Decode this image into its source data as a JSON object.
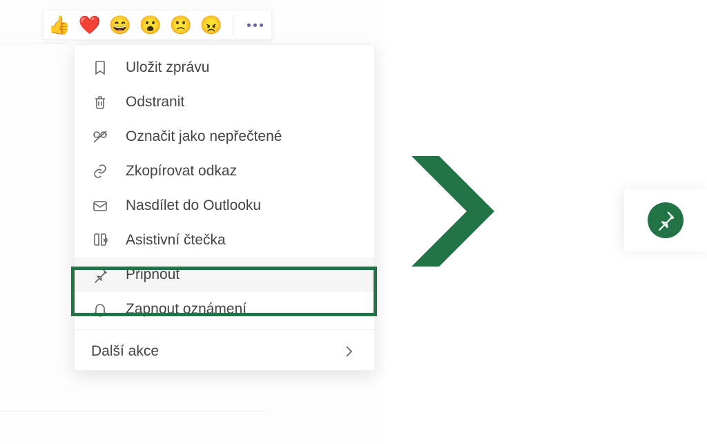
{
  "reactions": [
    "👍",
    "❤️",
    "😄",
    "😮",
    "🙁",
    "😠"
  ],
  "menu": {
    "items": [
      {
        "label": "Uložit zprávu",
        "icon": "bookmark"
      },
      {
        "label": "Odstranit",
        "icon": "trash"
      },
      {
        "label": "Označit jako nepřečtené",
        "icon": "unread"
      },
      {
        "label": "Zkopírovat odkaz",
        "icon": "link"
      },
      {
        "label": "Nasdílet do Outlooku",
        "icon": "mail"
      },
      {
        "label": "Asistivní čtečka",
        "icon": "reader"
      },
      {
        "label": "Připnout",
        "icon": "pin",
        "highlighted": true
      },
      {
        "label": "Zapnout oznámení",
        "icon": "bell"
      }
    ],
    "moreActions": "Další akce"
  },
  "colors": {
    "accent": "#217346",
    "purple": "#6264a7"
  }
}
